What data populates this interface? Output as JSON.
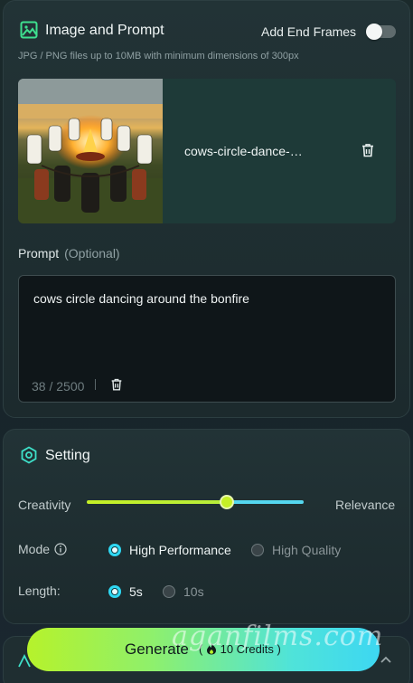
{
  "image_section": {
    "title": "Image and Prompt",
    "icon": "image-icon",
    "end_frames_label": "Add End Frames",
    "end_frames_on": false,
    "hint": "JPG / PNG files up to 10MB with minimum dimensions of 300px",
    "filename": "cows-circle-dance-…",
    "thumbnail": "cows dancing in a circle around a bonfire"
  },
  "prompt": {
    "label": "Prompt",
    "optional": "(Optional)",
    "value": "cows circle dancing around the bonfire",
    "counter": "38 / 2500"
  },
  "setting": {
    "title": "Setting",
    "icon": "hexagon-setting-icon",
    "creativity_label": "Creativity",
    "relevance_label": "Relevance",
    "slider_value": 0.65,
    "mode_label": "Mode",
    "mode_options": [
      "High Performance",
      "High Quality"
    ],
    "mode_selected": "High Performance",
    "length_label": "Length:",
    "length_options": [
      "5s",
      "10s"
    ],
    "length_selected": "5s"
  },
  "generate": {
    "label": "Generate",
    "credits": "10 Credits"
  },
  "watermark": "aganfilms.com",
  "colors": {
    "accent_green": "#c6f026",
    "accent_cyan": "#2fd7f2",
    "panel": "#1e3a38"
  }
}
